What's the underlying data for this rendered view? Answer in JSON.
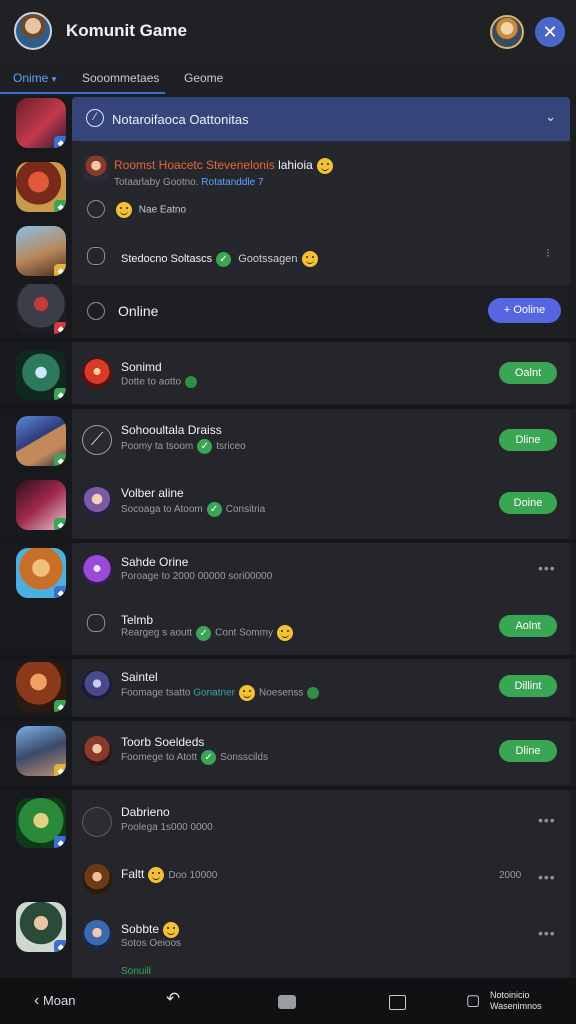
{
  "app": {
    "title": "Komunit Game"
  },
  "tabs": [
    {
      "label": "Onime"
    },
    {
      "label": "Sooommetaes"
    },
    {
      "label": "Geome"
    }
  ],
  "header": {
    "title": "Notaroifaoca Oattonitas"
  },
  "notifications": [
    {
      "name": "Roomst Hoacetc Stevenelonis",
      "name_suffix": "lahioia",
      "sub_a": "Totaarlaby Gootno.",
      "sub_b": "Rotatanddle 7"
    },
    {
      "name": "Nae Eatno"
    },
    {
      "name": "Stedocno Soltascs",
      "suffix": "Gootssagen"
    }
  ],
  "online_section": {
    "label": "Online",
    "button": "+ Ooline"
  },
  "rows": [
    {
      "name": "Sonimd",
      "sub": "Dotte to aotto",
      "status": "Oalnt"
    },
    {
      "name": "Sohooultala Draiss",
      "sub": "Poomy ta tsoom",
      "sub_b": "tsriceo",
      "status": "Dline"
    },
    {
      "name": "Volber aline",
      "sub": "Socoaga to Atoom",
      "sub_b": "Consitria",
      "status": "Doine"
    },
    {
      "name": "Sahde Orine",
      "sub": "Poroage to 2000 00000",
      "sub_b": "sori00000"
    },
    {
      "name": "Telmb",
      "sub": "Reargeg s aoutt",
      "sub_b": "Cont Sommy",
      "status": "Aolnt"
    },
    {
      "name": "Saintel",
      "sub": "Foomage tsatto",
      "sub_b": "Gonatner",
      "sub_c": "Noesenss",
      "status": "Dillint"
    },
    {
      "name": "Toorb Soeldeds",
      "sub": "Foomege to Atott",
      "sub_b": "Sonsscilds",
      "status": "Dline"
    },
    {
      "name": "Dabrieno",
      "sub": "Poolega 1s000 0000"
    },
    {
      "name": "Faltt",
      "sub": "Doo 10000"
    },
    {
      "name": "Sobbte",
      "sub": "Sotos Oeioos"
    },
    {
      "name": "Sonuill"
    }
  ],
  "right_labels": {
    "faltt": "2000"
  },
  "bottom_nav": {
    "back_label": "Moan",
    "right_label_1": "Notoinicio",
    "right_label_2": "Wasenimnos"
  },
  "colors": {
    "accent_blue": "#4a67c8",
    "online_green": "#3aa552",
    "header_blue": "#35457a",
    "notice_orange": "#e9673b"
  },
  "icons": [
    "close-icon",
    "check-icon",
    "more-icon",
    "back-icon",
    "undo-icon",
    "home-icon",
    "square-icon",
    "chat-icon"
  ]
}
